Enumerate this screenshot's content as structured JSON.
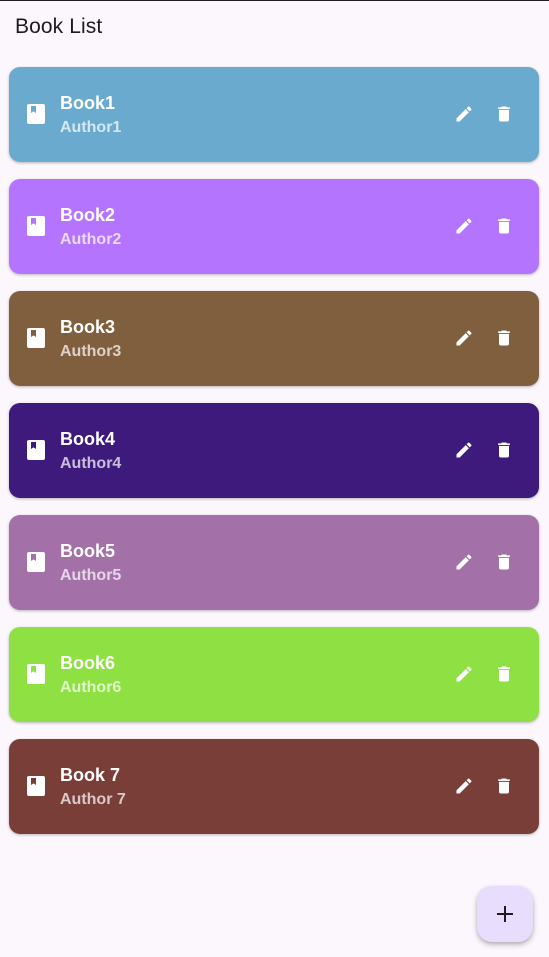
{
  "app_bar": {
    "title": "Book List"
  },
  "books": [
    {
      "title": "Book1",
      "author": "Author1",
      "color": "#6aaace"
    },
    {
      "title": "Book2",
      "author": "Author2",
      "color": "#b574fe"
    },
    {
      "title": "Book3",
      "author": "Author3",
      "color": "#805f3e"
    },
    {
      "title": "Book4",
      "author": "Author4",
      "color": "#3d1a7c"
    },
    {
      "title": "Book5",
      "author": "Author5",
      "color": "#a470a8"
    },
    {
      "title": "Book6",
      "author": "Author6",
      "color": "#8fe043"
    },
    {
      "title": "Book 7",
      "author": "Author 7",
      "color": "#7a3e39"
    }
  ],
  "icons": {
    "leading": "book-icon",
    "edit": "pencil-icon",
    "delete": "trash-icon",
    "fab": "plus-icon"
  },
  "colors": {
    "background": "#fbf7fd",
    "fab_background": "#e9ddfd",
    "fab_icon": "#1d1b20"
  }
}
